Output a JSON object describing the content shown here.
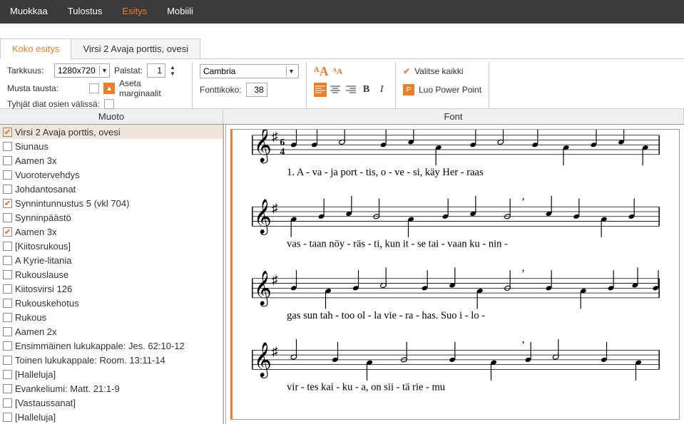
{
  "top_tabs": {
    "muokkaa": "Muokkaa",
    "tulostus": "Tulostus",
    "esitys": "Esitys",
    "mobiili": "Mobiili"
  },
  "sub_tabs": {
    "koko": "Koko esitys",
    "virsi": "Virsi 2 Avaja porttis, ovesi"
  },
  "toolbar": {
    "tarkkuus_label": "Tarkkuus:",
    "tarkkuus_value": "1280x720",
    "palstat_label": "Palstat:",
    "palstat_value": "1",
    "musta_label": "Musta tausta:",
    "aseta_label": "Aseta marginaalit",
    "tyhjat_label": "Tyhjät diat osien välissä:",
    "font_family": "Cambria",
    "fonttikoko_label": "Fonttikoko:",
    "fonttikoko_value": "38",
    "valitse_label": "Valitse kaikki",
    "luopp_label": "Luo Power Point"
  },
  "headers": {
    "muoto": "Muoto",
    "font": "Font"
  },
  "list": [
    {
      "label": "Virsi 2 Avaja porttis, ovesi",
      "checked": true,
      "sel": true
    },
    {
      "label": "Siunaus",
      "checked": false
    },
    {
      "label": "Aamen 3x",
      "checked": false
    },
    {
      "label": "Vuorotervehdys",
      "checked": false
    },
    {
      "label": "Johdantosanat",
      "checked": false
    },
    {
      "label": "Synnintunnustus 5 (vkl 704)",
      "checked": true
    },
    {
      "label": "Synninpäästö",
      "checked": false
    },
    {
      "label": "Aamen 3x",
      "checked": true
    },
    {
      "label": "[Kiitosrukous]",
      "checked": false
    },
    {
      "label": "A Kyrie-litania",
      "checked": false
    },
    {
      "label": "Rukouslause",
      "checked": false
    },
    {
      "label": "Kiitosvirsi 126",
      "checked": false
    },
    {
      "label": "Rukouskehotus",
      "checked": false
    },
    {
      "label": "Rukous",
      "checked": false
    },
    {
      "label": "Aamen 2x",
      "checked": false
    },
    {
      "label": "Ensimmäinen lukukappale: Jes. 62:10-12",
      "checked": false
    },
    {
      "label": "Toinen lukukappale: Room. 13:11-14",
      "checked": false
    },
    {
      "label": "[Halleluja]",
      "checked": false
    },
    {
      "label": "Evankeliumi: Matt. 21:1-9",
      "checked": false
    },
    {
      "label": "[Vastaussanat]",
      "checked": false
    },
    {
      "label": "[Halleluja]",
      "checked": false
    }
  ],
  "lyrics": {
    "l1": "1.  A - va  -  ja      port - tis,   o   -   ve   -  si,   käy   Her - raas",
    "l2": "vas - taan  nöy - räs  -  ti,    kun   it  -  se       tai - vaan   ku - nin -",
    "l3": "gas   sun  tah - too     ol - la   vie - ra   -   has.   Suo   i - lo -",
    "l4": "vir  -  tes     kai  -  ku    -    a,       on     sii  -  tä         rie  -  mu"
  }
}
